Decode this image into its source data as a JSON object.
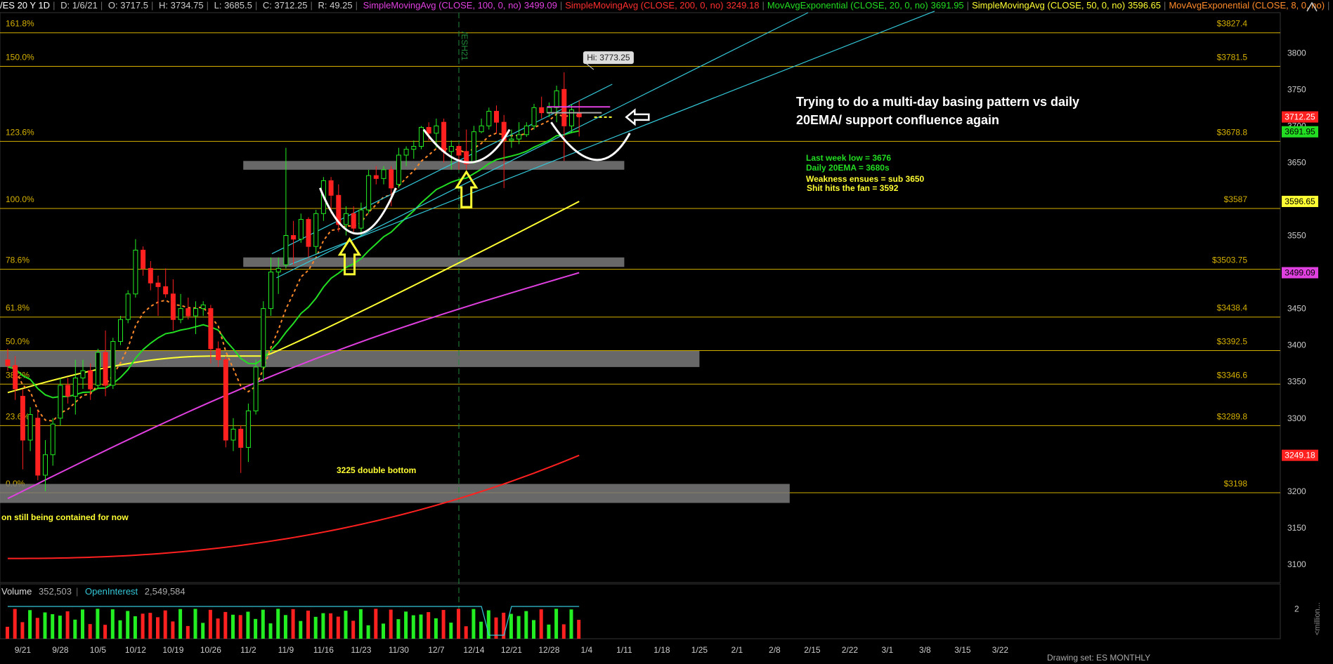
{
  "header": {
    "symbol": "/ES 20 Y 1D",
    "date": "D: 1/6/21",
    "open": "O: 3717.5",
    "high": "H: 3734.75",
    "low": "L: 3685.5",
    "close": "C: 3712.25",
    "range": "R: 49.25",
    "studies": [
      {
        "label": "SimpleMovingAvg (CLOSE, 100, 0, no)",
        "value": "3499.09",
        "color": "#e040e0"
      },
      {
        "label": "SimpleMovingAvg (CLOSE, 200, 0, no)",
        "value": "3249.18",
        "color": "#ff3030"
      },
      {
        "label": "MovAvgExponential (CLOSE, 20, 0, no)",
        "value": "3691.95",
        "color": "#22dd22"
      },
      {
        "label": "SimpleMovingAvg (CLOSE, 50, 0, no)",
        "value": "3596.65",
        "color": "#ffff33"
      },
      {
        "label": "MovAvgExponential (CLOSE, 8, 0, no)",
        "value": "",
        "color": "#ff8a2a"
      }
    ]
  },
  "volume_header": {
    "label": "Volume",
    "value": "352,503",
    "oi_label": "OpenInterest",
    "oi_value": "2,549,584"
  },
  "bottom_status": "Drawing set: ES MONTHLY",
  "colors": {
    "up": "#22ee22",
    "down": "#ff2020",
    "fib": "#d4b000",
    "zone": "#7a7a7a",
    "sma100": "#e040e0",
    "sma200": "#ff2020",
    "ema20": "#22dd22",
    "sma50": "#ffff33",
    "ema8": "#ff8a2a",
    "channel": "#33c8d8",
    "annot_yellow": "#ffff33",
    "annot_green": "#22dd22"
  },
  "chart_data": {
    "type": "candlestick",
    "title": "/ES 20 Y 1D",
    "x_ticks": [
      "9/21",
      "9/28",
      "10/5",
      "10/12",
      "10/19",
      "10/26",
      "11/2",
      "11/9",
      "11/16",
      "11/23",
      "11/30",
      "12/7",
      "12/14",
      "12/21",
      "12/28",
      "1/4",
      "1/11",
      "1/18",
      "1/25",
      "2/1",
      "2/8",
      "2/15",
      "2/22",
      "3/1",
      "3/8",
      "3/15",
      "3/22"
    ],
    "y_ticks": [
      3100,
      3150,
      3200,
      3250,
      3300,
      3350,
      3400,
      3450,
      3500,
      3550,
      3600,
      3650,
      3700,
      3750,
      3800
    ],
    "ylim": [
      3075,
      3855
    ],
    "candles": [
      {
        "date": "9/17",
        "o": 3380,
        "h": 3395,
        "l": 3365,
        "c": 3372
      },
      {
        "date": "9/18",
        "o": 3372,
        "h": 3385,
        "l": 3325,
        "c": 3340
      },
      {
        "date": "9/21",
        "o": 3330,
        "h": 3340,
        "l": 3230,
        "c": 3270
      },
      {
        "date": "9/22",
        "o": 3270,
        "h": 3315,
        "l": 3255,
        "c": 3305
      },
      {
        "date": "9/23",
        "o": 3300,
        "h": 3310,
        "l": 3215,
        "c": 3222
      },
      {
        "date": "9/24",
        "o": 3222,
        "h": 3270,
        "l": 3200,
        "c": 3250
      },
      {
        "date": "9/25",
        "o": 3250,
        "h": 3300,
        "l": 3235,
        "c": 3292
      },
      {
        "date": "9/28",
        "o": 3300,
        "h": 3355,
        "l": 3290,
        "c": 3345
      },
      {
        "date": "9/29",
        "o": 3345,
        "h": 3355,
        "l": 3320,
        "c": 3330
      },
      {
        "date": "9/30",
        "o": 3330,
        "h": 3380,
        "l": 3305,
        "c": 3355
      },
      {
        "date": "10/1",
        "o": 3355,
        "h": 3380,
        "l": 3340,
        "c": 3365
      },
      {
        "date": "10/2",
        "o": 3365,
        "h": 3375,
        "l": 3325,
        "c": 3340
      },
      {
        "date": "10/5",
        "o": 3345,
        "h": 3395,
        "l": 3340,
        "c": 3390
      },
      {
        "date": "10/6",
        "o": 3390,
        "h": 3420,
        "l": 3330,
        "c": 3345
      },
      {
        "date": "10/7",
        "o": 3345,
        "h": 3410,
        "l": 3340,
        "c": 3405
      },
      {
        "date": "10/8",
        "o": 3405,
        "h": 3440,
        "l": 3400,
        "c": 3435
      },
      {
        "date": "10/9",
        "o": 3435,
        "h": 3475,
        "l": 3430,
        "c": 3470
      },
      {
        "date": "10/12",
        "o": 3470,
        "h": 3545,
        "l": 3465,
        "c": 3530
      },
      {
        "date": "10/13",
        "o": 3530,
        "h": 3535,
        "l": 3495,
        "c": 3505
      },
      {
        "date": "10/14",
        "o": 3505,
        "h": 3515,
        "l": 3475,
        "c": 3485
      },
      {
        "date": "10/15",
        "o": 3485,
        "h": 3495,
        "l": 3440,
        "c": 3480
      },
      {
        "date": "10/16",
        "o": 3480,
        "h": 3505,
        "l": 3465,
        "c": 3470
      },
      {
        "date": "10/19",
        "o": 3470,
        "h": 3490,
        "l": 3420,
        "c": 3435
      },
      {
        "date": "10/20",
        "o": 3435,
        "h": 3470,
        "l": 3430,
        "c": 3450
      },
      {
        "date": "10/21",
        "o": 3450,
        "h": 3465,
        "l": 3435,
        "c": 3440
      },
      {
        "date": "10/22",
        "o": 3440,
        "h": 3460,
        "l": 3415,
        "c": 3450
      },
      {
        "date": "10/23",
        "o": 3450,
        "h": 3460,
        "l": 3440,
        "c": 3455
      },
      {
        "date": "10/26",
        "o": 3450,
        "h": 3455,
        "l": 3375,
        "c": 3395
      },
      {
        "date": "10/27",
        "o": 3395,
        "h": 3405,
        "l": 3370,
        "c": 3380
      },
      {
        "date": "10/28",
        "o": 3380,
        "h": 3385,
        "l": 3260,
        "c": 3270
      },
      {
        "date": "10/29",
        "o": 3270,
        "h": 3300,
        "l": 3255,
        "c": 3285
      },
      {
        "date": "10/30",
        "o": 3285,
        "h": 3290,
        "l": 3225,
        "c": 3260
      },
      {
        "date": "11/2",
        "o": 3260,
        "h": 3320,
        "l": 3240,
        "c": 3310
      },
      {
        "date": "11/3",
        "o": 3310,
        "h": 3380,
        "l": 3305,
        "c": 3370
      },
      {
        "date": "11/4",
        "o": 3370,
        "h": 3460,
        "l": 3350,
        "c": 3450
      },
      {
        "date": "11/5",
        "o": 3450,
        "h": 3520,
        "l": 3440,
        "c": 3500
      },
      {
        "date": "11/6",
        "o": 3500,
        "h": 3520,
        "l": 3470,
        "c": 3505
      },
      {
        "date": "11/9",
        "o": 3510,
        "h": 3670,
        "l": 3505,
        "c": 3550
      },
      {
        "date": "11/10",
        "o": 3550,
        "h": 3570,
        "l": 3510,
        "c": 3545
      },
      {
        "date": "11/11",
        "o": 3545,
        "h": 3580,
        "l": 3540,
        "c": 3572
      },
      {
        "date": "11/12",
        "o": 3572,
        "h": 3575,
        "l": 3520,
        "c": 3535
      },
      {
        "date": "11/13",
        "o": 3535,
        "h": 3585,
        "l": 3525,
        "c": 3580
      },
      {
        "date": "11/16",
        "o": 3580,
        "h": 3630,
        "l": 3570,
        "c": 3625
      },
      {
        "date": "11/17",
        "o": 3625,
        "h": 3630,
        "l": 3580,
        "c": 3605
      },
      {
        "date": "11/18",
        "o": 3605,
        "h": 3620,
        "l": 3555,
        "c": 3565
      },
      {
        "date": "11/19",
        "o": 3565,
        "h": 3590,
        "l": 3550,
        "c": 3580
      },
      {
        "date": "11/20",
        "o": 3580,
        "h": 3590,
        "l": 3555,
        "c": 3560
      },
      {
        "date": "11/23",
        "o": 3560,
        "h": 3595,
        "l": 3550,
        "c": 3585
      },
      {
        "date": "11/24",
        "o": 3585,
        "h": 3640,
        "l": 3580,
        "c": 3632
      },
      {
        "date": "11/25",
        "o": 3632,
        "h": 3645,
        "l": 3620,
        "c": 3628
      },
      {
        "date": "11/27",
        "o": 3628,
        "h": 3645,
        "l": 3620,
        "c": 3640
      },
      {
        "date": "11/30",
        "o": 3640,
        "h": 3645,
        "l": 3590,
        "c": 3615
      },
      {
        "date": "12/1",
        "o": 3620,
        "h": 3670,
        "l": 3615,
        "c": 3660
      },
      {
        "date": "12/2",
        "o": 3660,
        "h": 3672,
        "l": 3645,
        "c": 3668
      },
      {
        "date": "12/3",
        "o": 3668,
        "h": 3680,
        "l": 3655,
        "c": 3672
      },
      {
        "date": "12/4",
        "o": 3672,
        "h": 3700,
        "l": 3668,
        "c": 3698
      },
      {
        "date": "12/7",
        "o": 3698,
        "h": 3705,
        "l": 3680,
        "c": 3690
      },
      {
        "date": "12/8",
        "o": 3690,
        "h": 3710,
        "l": 3670,
        "c": 3700
      },
      {
        "date": "12/9",
        "o": 3705,
        "h": 3710,
        "l": 3650,
        "c": 3665
      },
      {
        "date": "12/10",
        "o": 3665,
        "h": 3680,
        "l": 3640,
        "c": 3672
      },
      {
        "date": "12/11",
        "o": 3672,
        "h": 3675,
        "l": 3640,
        "c": 3660
      },
      {
        "date": "12/14",
        "o": 3665,
        "h": 3695,
        "l": 3640,
        "c": 3648
      },
      {
        "date": "12/15",
        "o": 3650,
        "h": 3700,
        "l": 3648,
        "c": 3692
      },
      {
        "date": "12/16",
        "o": 3692,
        "h": 3710,
        "l": 3690,
        "c": 3700
      },
      {
        "date": "12/17",
        "o": 3700,
        "h": 3725,
        "l": 3695,
        "c": 3720
      },
      {
        "date": "12/18",
        "o": 3720,
        "h": 3728,
        "l": 3690,
        "c": 3705
      },
      {
        "date": "12/21",
        "o": 3705,
        "h": 3715,
        "l": 3615,
        "c": 3680
      },
      {
        "date": "12/22",
        "o": 3680,
        "h": 3695,
        "l": 3670,
        "c": 3682
      },
      {
        "date": "12/23",
        "o": 3682,
        "h": 3705,
        "l": 3675,
        "c": 3688
      },
      {
        "date": "12/24",
        "o": 3688,
        "h": 3705,
        "l": 3685,
        "c": 3700
      },
      {
        "date": "12/28",
        "o": 3700,
        "h": 3730,
        "l": 3695,
        "c": 3725
      },
      {
        "date": "12/29",
        "o": 3725,
        "h": 3740,
        "l": 3710,
        "c": 3718
      },
      {
        "date": "12/30",
        "o": 3718,
        "h": 3732,
        "l": 3712,
        "c": 3725
      },
      {
        "date": "12/31",
        "o": 3725,
        "h": 3755,
        "l": 3705,
        "c": 3748
      },
      {
        "date": "1/4",
        "o": 3750,
        "h": 3773.25,
        "l": 3652,
        "c": 3700
      },
      {
        "date": "1/5",
        "o": 3700,
        "h": 3730,
        "l": 3690,
        "c": 3722
      },
      {
        "date": "1/6",
        "o": 3717.5,
        "h": 3734.75,
        "l": 3685.5,
        "c": 3712.25
      }
    ],
    "volume": {
      "ylim": [
        0,
        3
      ],
      "y_ticks": [
        2
      ],
      "label": "Volume",
      "unit_label": "<million..."
    },
    "fib_levels": [
      {
        "label": "0.0%",
        "price": "$3198",
        "value": 3198
      },
      {
        "label": "23.6%",
        "price": "$3289.8",
        "value": 3289.8
      },
      {
        "label": "38.2%",
        "price": "$3346.6",
        "value": 3346.6
      },
      {
        "label": "50.0%",
        "price": "$3392.5",
        "value": 3392.5
      },
      {
        "label": "61.8%",
        "price": "$3438.4",
        "value": 3438.4
      },
      {
        "label": "78.6%",
        "price": "$3503.75",
        "value": 3503.75
      },
      {
        "label": "100.0%",
        "price": "$3587",
        "value": 3587
      },
      {
        "label": "123.6%",
        "price": "$3678.8",
        "value": 3678.8
      },
      {
        "label": "150.0%",
        "price": "$3781.5",
        "value": 3781.5
      },
      {
        "label": "161.8%",
        "price": "$3827.4",
        "value": 3827.4
      }
    ],
    "zones": [
      {
        "from_date": "11/6",
        "to_date": "1/11",
        "low": 3640,
        "high": 3652
      },
      {
        "from_date": "11/6",
        "to_date": "1/11",
        "low": 3507,
        "high": 3520
      },
      {
        "from_date": "9/17",
        "to_date": "1/25",
        "low": 3370,
        "high": 3392
      },
      {
        "from_date": "9/17",
        "to_date": "2/10",
        "low": 3184,
        "high": 3210
      }
    ],
    "price_tags": [
      {
        "text": "3712.25",
        "value": 3712.25,
        "bg": "#ff2020",
        "fg": "#ffffff"
      },
      {
        "text": "3691.95",
        "value": 3691.95,
        "bg": "#22dd22",
        "fg": "#000000"
      },
      {
        "text": "3596.65",
        "value": 3596.65,
        "bg": "#ffff33",
        "fg": "#000000"
      },
      {
        "text": "3499.09",
        "value": 3499.09,
        "bg": "#e040e0",
        "fg": "#000000"
      },
      {
        "text": "3249.18",
        "value": 3249.18,
        "bg": "#ff2020",
        "fg": "#ffffff"
      }
    ],
    "vertical_marker": {
      "date": "12/10",
      "label": "/ESH21"
    },
    "high_tag": "Hi: 3773.25",
    "annotations": {
      "main": "Trying to do a multi-day basing pattern vs daily 20EMA/ support confluence again",
      "main_line1": "Trying to do a multi-day basing pattern vs daily",
      "main_line2": "20EMA/ support confluence again",
      "last_week_low": "Last week low = 3676",
      "daily_20ema": "Daily 20EMA = 3680s",
      "weakness": "Weakness ensues = sub 3650",
      "shit": "Shit hits the fan = 3592",
      "double_bottom": "3225 double bottom",
      "contained": "on still being contained for now"
    }
  }
}
